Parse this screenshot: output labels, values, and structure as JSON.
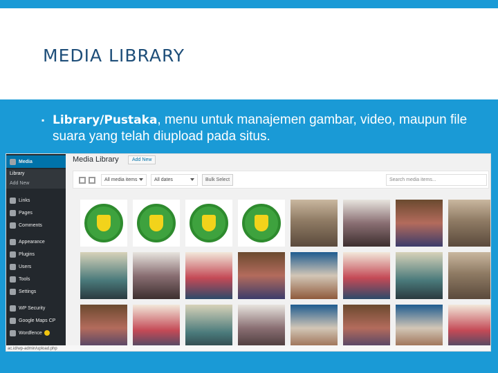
{
  "slide": {
    "title": "MEDIA LIBRARY",
    "bullet_term": "Library/Pustaka",
    "bullet_text": ", menu untuk manajemen gambar, video, maupun file suara yang telah diupload pada situs."
  },
  "wp": {
    "sidebar": [
      {
        "label": "Media",
        "icon": "media-icon",
        "active": true
      },
      {
        "label": "Links",
        "icon": "links-icon"
      },
      {
        "label": "Pages",
        "icon": "pages-icon"
      },
      {
        "label": "Comments",
        "icon": "comments-icon"
      },
      {
        "label": "Appearance",
        "icon": "appearance-icon"
      },
      {
        "label": "Plugins",
        "icon": "plugins-icon"
      },
      {
        "label": "Users",
        "icon": "users-icon"
      },
      {
        "label": "Tools",
        "icon": "tools-icon"
      },
      {
        "label": "Settings",
        "icon": "settings-icon"
      },
      {
        "label": "WP Security",
        "icon": "shield-icon"
      },
      {
        "label": "Google Maps CP",
        "icon": "map-icon"
      },
      {
        "label": "Wordfence",
        "icon": "wordfence-icon"
      }
    ],
    "submenu": {
      "library": "Library",
      "add_new": "Add New"
    },
    "page_title": "Media Library",
    "add_new_button": "Add New",
    "filter_type": "All media items",
    "filter_date": "All dates",
    "bulk_select": "Bulk Select",
    "search_placeholder": "Search media items...",
    "status_url": "ac.id/wp-admin/upload.php"
  }
}
